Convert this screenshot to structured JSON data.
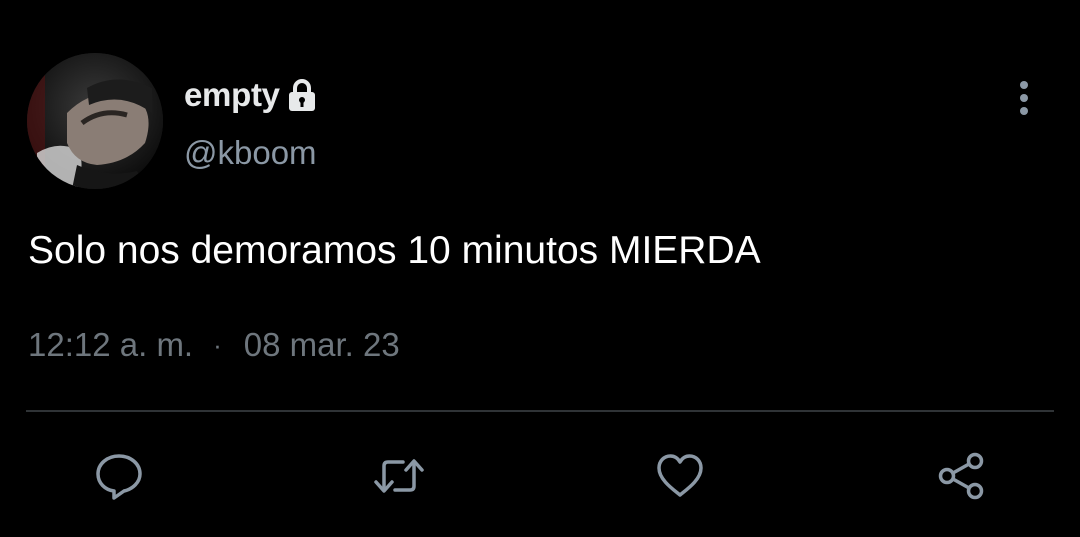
{
  "author": {
    "display_name": "empty",
    "handle": "@kboom",
    "protected_icon": "lock-icon",
    "avatar_icon": "profile-photo"
  },
  "tweet": {
    "text": "Solo nos demoramos 10 minutos MIERDA",
    "time": "12:12 a. m.",
    "separator": "·",
    "date": "08 mar. 23"
  },
  "menu": {
    "icon": "more-vertical-icon"
  },
  "actions": {
    "reply_icon": "reply-icon",
    "retweet_icon": "retweet-icon",
    "like_icon": "heart-icon",
    "share_icon": "share-icon"
  },
  "colors": {
    "background": "#000000",
    "primary_text": "#e7e9ea",
    "secondary_text": "#8b98a5",
    "meta_text": "#6e767d",
    "icon": "#8b98a5",
    "divider": "#2f3336"
  }
}
